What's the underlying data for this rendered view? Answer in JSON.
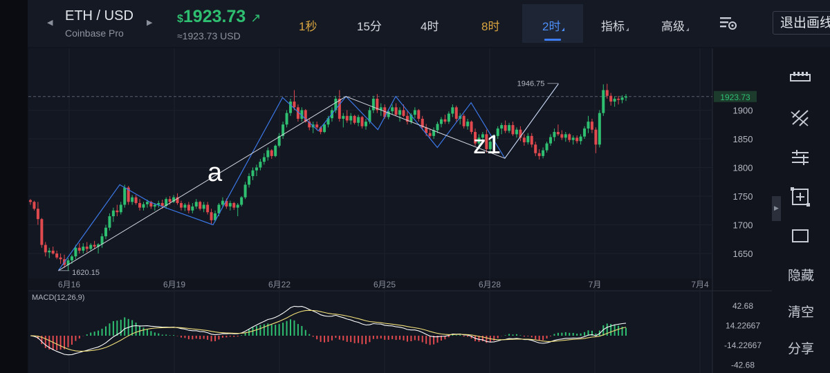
{
  "header": {
    "pair": "ETH / USD",
    "exchange": "Coinbase Pro",
    "price_currency": "$",
    "price": "1923.73",
    "price_arrow": "↗",
    "price_usd": "≈1923.73 USD",
    "price_color": "#2fbf71",
    "prev_arrow": "◀",
    "next_arrow": "▶"
  },
  "timeframes": [
    {
      "label": "1秒",
      "color": "#d9a440"
    },
    {
      "label": "15分",
      "color": "#d6d9df"
    },
    {
      "label": "4时",
      "color": "#d6d9df"
    },
    {
      "label": "8时",
      "color": "#d9a440"
    },
    {
      "label": "2时",
      "color": "#4d8ef7",
      "active": true
    }
  ],
  "menus": {
    "indicators": "指标",
    "advanced": "高级"
  },
  "exit_button": "退出画线",
  "right_toolbar": {
    "icons": [
      "ruler-icon",
      "draw-lines-icon",
      "horizontal-lines-icon",
      "add-measure-icon",
      "rectangle-icon"
    ],
    "hide": "隐藏",
    "clear": "清空",
    "share": "分享"
  },
  "chart_data": {
    "type": "candlestick",
    "symbol": "ETH / USD",
    "interval": "2时",
    "y_ticks": [
      1900,
      1850,
      1800,
      1750,
      1700,
      1650
    ],
    "ylim": [
      1612,
      1970
    ],
    "x_ticks": [
      "6月16",
      "6月19",
      "6月22",
      "6月25",
      "6月28",
      "7月",
      "7月4"
    ],
    "last_price_label": "1923.73",
    "last_price": 1923.73,
    "high_label": "1946.75",
    "high": 1946.75,
    "low_label": "1620.15",
    "low": 1620.15,
    "annotations": [
      "a",
      "z1"
    ],
    "candle_colors": {
      "up": "#2fbf71",
      "down": "#e0494e"
    },
    "candles": [
      [
        1743,
        1745,
        1735,
        1740
      ],
      [
        1740,
        1742,
        1725,
        1728
      ],
      [
        1728,
        1740,
        1700,
        1710
      ],
      [
        1710,
        1712,
        1660,
        1665
      ],
      [
        1665,
        1670,
        1645,
        1652
      ],
      [
        1652,
        1660,
        1642,
        1655
      ],
      [
        1655,
        1662,
        1648,
        1650
      ],
      [
        1650,
        1655,
        1640,
        1643
      ],
      [
        1643,
        1650,
        1632,
        1640
      ],
      [
        1640,
        1648,
        1625,
        1630
      ],
      [
        1630,
        1642,
        1620,
        1638
      ],
      [
        1638,
        1648,
        1632,
        1645
      ],
      [
        1645,
        1665,
        1640,
        1660
      ],
      [
        1660,
        1668,
        1650,
        1655
      ],
      [
        1655,
        1668,
        1650,
        1662
      ],
      [
        1662,
        1670,
        1652,
        1658
      ],
      [
        1658,
        1668,
        1654,
        1665
      ],
      [
        1665,
        1672,
        1658,
        1662
      ],
      [
        1662,
        1668,
        1650,
        1666
      ],
      [
        1666,
        1685,
        1660,
        1680
      ],
      [
        1680,
        1700,
        1675,
        1695
      ],
      [
        1695,
        1720,
        1690,
        1715
      ],
      [
        1715,
        1730,
        1705,
        1725
      ],
      [
        1725,
        1735,
        1715,
        1722
      ],
      [
        1722,
        1740,
        1718,
        1735
      ],
      [
        1735,
        1770,
        1730,
        1765
      ],
      [
        1765,
        1768,
        1735,
        1740
      ],
      [
        1740,
        1752,
        1735,
        1748
      ],
      [
        1748,
        1752,
        1735,
        1738
      ],
      [
        1738,
        1745,
        1725,
        1730
      ],
      [
        1730,
        1740,
        1725,
        1736
      ],
      [
        1736,
        1744,
        1730,
        1740
      ],
      [
        1740,
        1742,
        1728,
        1732
      ],
      [
        1732,
        1738,
        1725,
        1735
      ],
      [
        1735,
        1742,
        1730,
        1738
      ],
      [
        1738,
        1744,
        1728,
        1733
      ],
      [
        1733,
        1748,
        1728,
        1745
      ],
      [
        1745,
        1750,
        1735,
        1740
      ],
      [
        1740,
        1752,
        1738,
        1748
      ],
      [
        1748,
        1755,
        1735,
        1738
      ],
      [
        1738,
        1742,
        1725,
        1730
      ],
      [
        1730,
        1738,
        1724,
        1735
      ],
      [
        1735,
        1740,
        1720,
        1725
      ],
      [
        1725,
        1738,
        1720,
        1732
      ],
      [
        1732,
        1745,
        1728,
        1740
      ],
      [
        1740,
        1742,
        1725,
        1728
      ],
      [
        1728,
        1740,
        1722,
        1735
      ],
      [
        1735,
        1740,
        1718,
        1722
      ],
      [
        1722,
        1728,
        1700,
        1708
      ],
      [
        1708,
        1725,
        1705,
        1720
      ],
      [
        1720,
        1738,
        1715,
        1735
      ],
      [
        1735,
        1748,
        1730,
        1742
      ],
      [
        1742,
        1746,
        1728,
        1732
      ],
      [
        1732,
        1742,
        1725,
        1738
      ],
      [
        1738,
        1740,
        1726,
        1730
      ],
      [
        1730,
        1738,
        1715,
        1735
      ],
      [
        1735,
        1750,
        1732,
        1748
      ],
      [
        1748,
        1775,
        1745,
        1770
      ],
      [
        1770,
        1790,
        1765,
        1785
      ],
      [
        1785,
        1800,
        1778,
        1795
      ],
      [
        1795,
        1805,
        1785,
        1800
      ],
      [
        1800,
        1815,
        1795,
        1810
      ],
      [
        1810,
        1825,
        1805,
        1818
      ],
      [
        1818,
        1835,
        1812,
        1830
      ],
      [
        1830,
        1832,
        1815,
        1820
      ],
      [
        1820,
        1840,
        1818,
        1838
      ],
      [
        1838,
        1860,
        1835,
        1855
      ],
      [
        1855,
        1880,
        1850,
        1875
      ],
      [
        1875,
        1900,
        1870,
        1895
      ],
      [
        1895,
        1920,
        1890,
        1915
      ],
      [
        1915,
        1935,
        1900,
        1905
      ],
      [
        1905,
        1910,
        1880,
        1885
      ],
      [
        1885,
        1905,
        1880,
        1900
      ],
      [
        1900,
        1902,
        1878,
        1880
      ],
      [
        1880,
        1885,
        1865,
        1870
      ],
      [
        1870,
        1880,
        1860,
        1875
      ],
      [
        1875,
        1880,
        1865,
        1870
      ],
      [
        1870,
        1872,
        1858,
        1862
      ],
      [
        1862,
        1878,
        1860,
        1875
      ],
      [
        1875,
        1890,
        1870,
        1886
      ],
      [
        1886,
        1905,
        1880,
        1900
      ],
      [
        1900,
        1925,
        1895,
        1920
      ],
      [
        1920,
        1935,
        1880,
        1885
      ],
      [
        1885,
        1895,
        1870,
        1890
      ],
      [
        1890,
        1900,
        1878,
        1882
      ],
      [
        1882,
        1895,
        1875,
        1890
      ],
      [
        1890,
        1892,
        1875,
        1878
      ],
      [
        1878,
        1892,
        1872,
        1888
      ],
      [
        1888,
        1890,
        1868,
        1872
      ],
      [
        1872,
        1885,
        1866,
        1880
      ],
      [
        1880,
        1905,
        1876,
        1900
      ],
      [
        1900,
        1925,
        1895,
        1920
      ],
      [
        1920,
        1928,
        1895,
        1900
      ],
      [
        1900,
        1912,
        1890,
        1905
      ],
      [
        1905,
        1910,
        1885,
        1888
      ],
      [
        1888,
        1902,
        1884,
        1898
      ],
      [
        1898,
        1910,
        1892,
        1905
      ],
      [
        1905,
        1912,
        1890,
        1892
      ],
      [
        1892,
        1905,
        1880,
        1900
      ],
      [
        1900,
        1910,
        1888,
        1890
      ],
      [
        1890,
        1898,
        1875,
        1880
      ],
      [
        1880,
        1895,
        1876,
        1892
      ],
      [
        1892,
        1905,
        1886,
        1900
      ],
      [
        1900,
        1902,
        1880,
        1885
      ],
      [
        1885,
        1890,
        1865,
        1870
      ],
      [
        1870,
        1876,
        1855,
        1860
      ],
      [
        1860,
        1868,
        1850,
        1855
      ],
      [
        1855,
        1870,
        1850,
        1865
      ],
      [
        1865,
        1880,
        1860,
        1876
      ],
      [
        1876,
        1888,
        1870,
        1884
      ],
      [
        1884,
        1892,
        1876,
        1880
      ],
      [
        1880,
        1898,
        1876,
        1894
      ],
      [
        1894,
        1910,
        1888,
        1905
      ],
      [
        1905,
        1908,
        1880,
        1885
      ],
      [
        1885,
        1895,
        1875,
        1890
      ],
      [
        1890,
        1893,
        1868,
        1872
      ],
      [
        1872,
        1885,
        1866,
        1880
      ],
      [
        1880,
        1882,
        1858,
        1862
      ],
      [
        1862,
        1868,
        1838,
        1842
      ],
      [
        1842,
        1858,
        1836,
        1852
      ],
      [
        1852,
        1862,
        1845,
        1858
      ],
      [
        1858,
        1866,
        1826,
        1832
      ],
      [
        1832,
        1848,
        1826,
        1845
      ],
      [
        1845,
        1858,
        1838,
        1855
      ],
      [
        1855,
        1872,
        1850,
        1868
      ],
      [
        1868,
        1878,
        1858,
        1874
      ],
      [
        1874,
        1882,
        1860,
        1864
      ],
      [
        1864,
        1878,
        1860,
        1874
      ],
      [
        1874,
        1880,
        1855,
        1858
      ],
      [
        1858,
        1870,
        1852,
        1866
      ],
      [
        1866,
        1872,
        1846,
        1852
      ],
      [
        1852,
        1858,
        1838,
        1844
      ],
      [
        1844,
        1860,
        1840,
        1855
      ],
      [
        1855,
        1860,
        1835,
        1840
      ],
      [
        1840,
        1845,
        1820,
        1825
      ],
      [
        1825,
        1832,
        1814,
        1820
      ],
      [
        1820,
        1835,
        1816,
        1830
      ],
      [
        1830,
        1845,
        1826,
        1842
      ],
      [
        1842,
        1858,
        1838,
        1853
      ],
      [
        1853,
        1868,
        1846,
        1862
      ],
      [
        1862,
        1875,
        1855,
        1858
      ],
      [
        1858,
        1865,
        1848,
        1852
      ],
      [
        1852,
        1862,
        1845,
        1858
      ],
      [
        1858,
        1860,
        1844,
        1848
      ],
      [
        1848,
        1856,
        1840,
        1852
      ],
      [
        1852,
        1856,
        1842,
        1846
      ],
      [
        1846,
        1858,
        1840,
        1854
      ],
      [
        1854,
        1872,
        1850,
        1868
      ],
      [
        1868,
        1890,
        1860,
        1880
      ],
      [
        1880,
        1885,
        1860,
        1866
      ],
      [
        1866,
        1870,
        1825,
        1840
      ],
      [
        1840,
        1900,
        1835,
        1895
      ],
      [
        1895,
        1945,
        1890,
        1935
      ],
      [
        1935,
        1946,
        1920,
        1925
      ],
      [
        1925,
        1930,
        1908,
        1915
      ],
      [
        1915,
        1924,
        1906,
        1920
      ],
      [
        1920,
        1925,
        1910,
        1918
      ],
      [
        1918,
        1926,
        1912,
        1922
      ],
      [
        1922,
        1928,
        1916,
        1924
      ]
    ],
    "macd": {
      "label": "MACD(12,26,9)",
      "y_ticks": [
        "42.68",
        "14.22667",
        "-14.22667",
        "-42.68"
      ],
      "y_tick_values": [
        42.68,
        14.22667,
        -14.22667,
        -42.68
      ],
      "dif_color": "#ffffff",
      "dea_color": "#f2e07a"
    }
  }
}
